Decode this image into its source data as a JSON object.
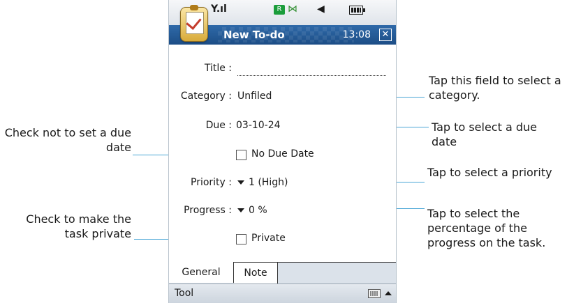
{
  "window": {
    "title": "New To-do",
    "clock": "13:08"
  },
  "status": {
    "signal": "Y.ıl",
    "roaming_badge": "R"
  },
  "form": {
    "title_label": "Title :",
    "title_value": "",
    "category_label": "Category :",
    "category_value": "Unfiled",
    "due_label": "Due :",
    "due_value": "03-10-24",
    "no_due_label": "No Due Date",
    "priority_label": "Priority :",
    "priority_value": "1 (High)",
    "progress_label": "Progress :",
    "progress_value": "0 %",
    "private_label": "Private"
  },
  "tabs": [
    {
      "label": "General"
    },
    {
      "label": "Note"
    }
  ],
  "toolbar": {
    "label": "Tool"
  },
  "annotations": {
    "category": "Tap this field to select a category.",
    "due": "Tap to select a due date",
    "no_due": "Check not to set a due date",
    "priority": "Tap to select a priority",
    "private": "Check to make the task private",
    "progress": "Tap to select the percentage of the progress on the task."
  },
  "colors": {
    "accent": "#1c4d86",
    "callout_line": "#4aa6d6"
  }
}
